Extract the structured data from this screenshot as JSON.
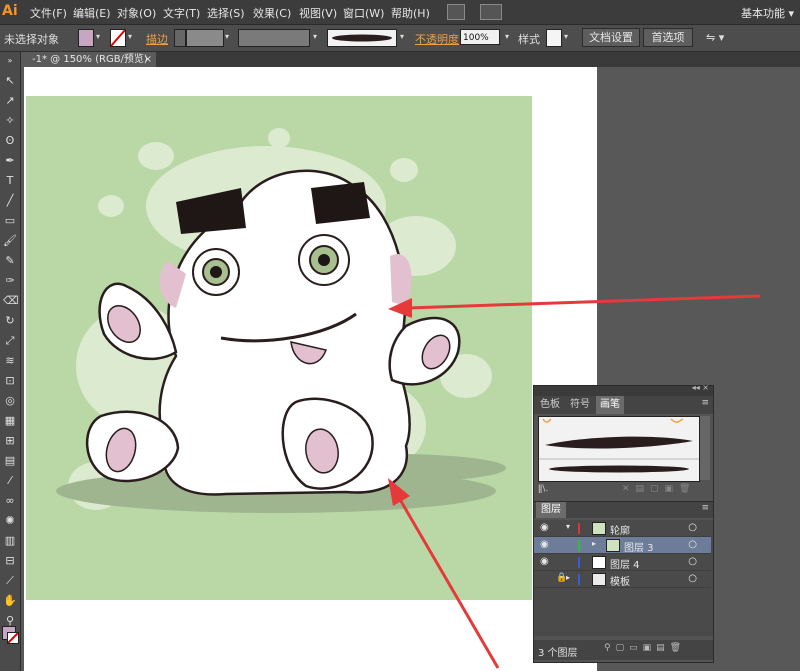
{
  "app": {
    "logo": "Ai",
    "workspace": "基本功能 ▾"
  },
  "menu": [
    "文件(F)",
    "编辑(E)",
    "对象(O)",
    "文字(T)",
    "选择(S)",
    "效果(C)",
    "视图(V)",
    "窗口(W)",
    "帮助(H)"
  ],
  "control": {
    "selection": "未选择对象",
    "stroke_label": "描边",
    "opacity_label": "不透明度",
    "opacity_value": "100%",
    "style_label": "样式",
    "doc_settings": "文档设置",
    "preferences": "首选项"
  },
  "document": {
    "tab_title": "-1* @ 150% (RGB/预览)"
  },
  "brushes_panel": {
    "tabs": [
      "色板",
      "符号",
      "画笔"
    ],
    "active_tab": "画笔"
  },
  "layers_panel": {
    "title": "图层",
    "rows": [
      {
        "name": "轮廓",
        "color": "#e03434"
      },
      {
        "name": "图层 3",
        "color": "#2fbf2f"
      },
      {
        "name": "图层 4",
        "color": "#3b5bd6"
      },
      {
        "name": "模板",
        "color": "#3b5bd6"
      }
    ],
    "footer": "3 个图层"
  },
  "colors": {
    "accent": "#f7941d",
    "artboard_bg": "#b9d8a6",
    "arrow": "#e63a3a"
  }
}
